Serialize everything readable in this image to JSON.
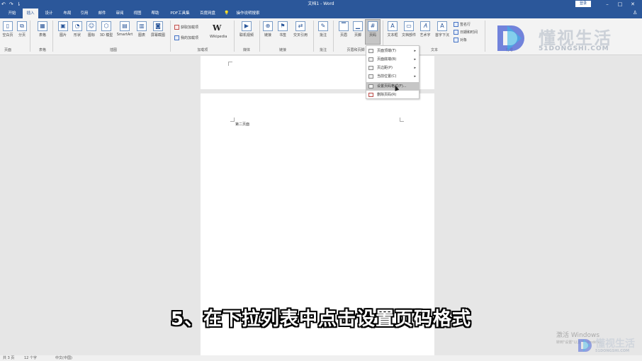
{
  "titlebar": {
    "qat": [
      "↶",
      "↷",
      "⇂"
    ],
    "title": "文档1 - Word",
    "login": "登录",
    "minimize": "–",
    "restore": "□",
    "close": "✕"
  },
  "tabs": [
    "开始",
    "插入",
    "设计",
    "布局",
    "引用",
    "邮件",
    "审阅",
    "视图",
    "帮助",
    "PDF工具集",
    "百度网盘",
    "操作说明搜索"
  ],
  "tab_bulb": "💡",
  "ribbon": {
    "blank_page": "空白页",
    "page_break": "分页",
    "table": "表格",
    "picture": "图片",
    "shapes": "形状",
    "icons": "图标",
    "model3d": "3D 模型",
    "smartart": "SmartArt",
    "chart": "图表",
    "screenshot": "屏幕截图",
    "get_addins": "获取加载项",
    "my_addins": "我的加载项",
    "wiki_icon": "W",
    "wikipedia": "Wikipedia",
    "online_video": "联机视频",
    "link": "链接",
    "bookmark": "书签",
    "cross_ref": "交叉引用",
    "comment": "批注",
    "header": "页眉",
    "footer": "页脚",
    "page_number": "页码",
    "textbox": "文本框",
    "quick_parts": "文档部件",
    "wordart": "艺术字",
    "dropcap": "首字下沉",
    "signature": "签名行",
    "datetime": "日期和时间",
    "object": "对象",
    "groups": {
      "pages": "页面",
      "tables": "表格",
      "illustrations": "插图",
      "addins": "加载项",
      "media": "媒体",
      "links": "链接",
      "comments": "批注",
      "header_footer": "页眉和页脚",
      "text": "文本",
      "symbols": "符号"
    }
  },
  "logo": {
    "cn": "懂视生活",
    "en": "51DONGSHI.COM"
  },
  "page_text": "第二页面",
  "menu": {
    "items": [
      {
        "label": "页面顶端(T)",
        "has_arrow": true
      },
      {
        "label": "页面底端(B)",
        "has_arrow": true
      },
      {
        "label": "页边距(P)",
        "has_arrow": true
      },
      {
        "label": "当前位置(C)",
        "has_arrow": true
      },
      {
        "label": "设置页码格式(F)...",
        "has_arrow": false
      },
      {
        "label": "删除页码(R)",
        "has_arrow": false
      }
    ],
    "arrow": "▸"
  },
  "subtitle": "5、在下拉列表中点击设置页码格式",
  "watermark": {
    "activate": "激活 Windows",
    "activate_sub": "转到\"设置\"以激活 Windows。",
    "logo_cn": "懂视生活",
    "logo_en": "51DONGSHI.COM"
  },
  "status": {
    "pages": "共 3 页",
    "words": "12 个字",
    "lang": "中文(中国)"
  },
  "colors": {
    "word_blue": "#2b579a",
    "ribbon_bg": "#f3f3f3",
    "canvas_bg": "#e6e6e6"
  }
}
